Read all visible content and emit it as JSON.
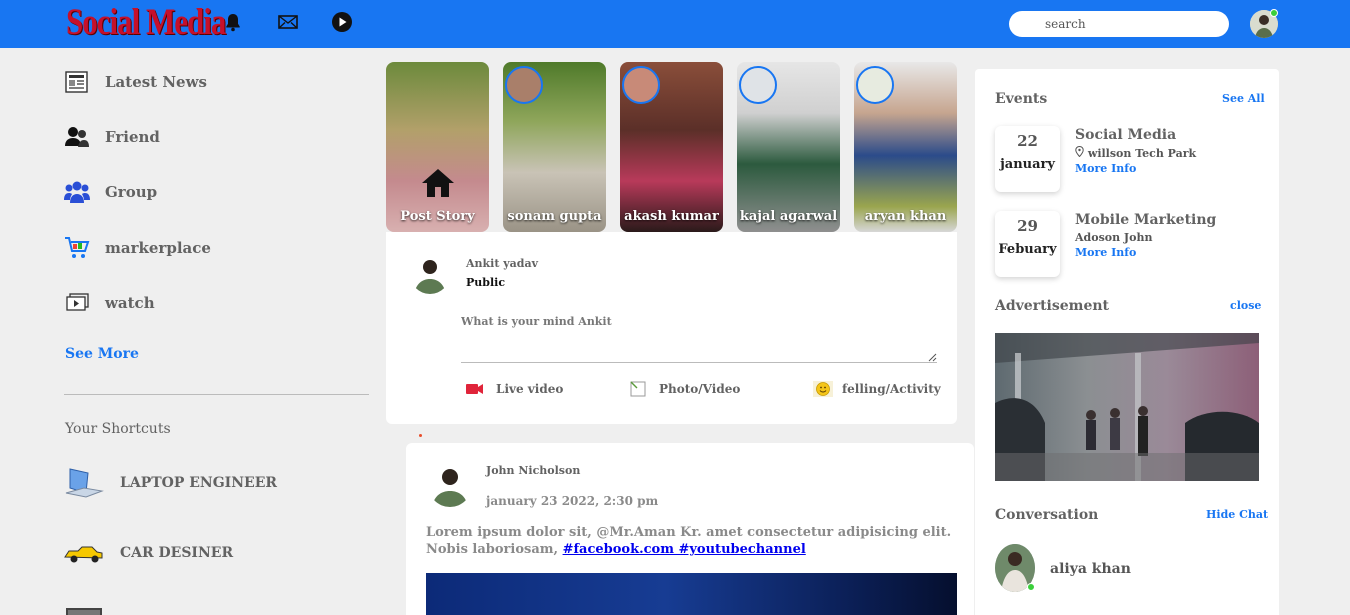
{
  "topbar": {
    "logo": "Social Media",
    "icons": [
      "bell-icon",
      "mail-icon",
      "play-icon"
    ],
    "search_placeholder": "search",
    "brand_color": "#1876f2"
  },
  "left_nav": {
    "items": [
      {
        "label": "Latest News",
        "icon": "newspaper-icon"
      },
      {
        "label": "Friend",
        "icon": "friends-icon"
      },
      {
        "label": "Group",
        "icon": "group-icon"
      },
      {
        "label": "markerplace",
        "icon": "cart-icon"
      },
      {
        "label": "watch",
        "icon": "video-icon"
      }
    ],
    "see_more": "See More",
    "shortcuts_title": "Your Shortcuts",
    "shortcuts": [
      {
        "label": "LAPTOP ENGINEER",
        "icon": "laptop-icon"
      },
      {
        "label": "CAR DESINER",
        "icon": "car-icon"
      }
    ]
  },
  "stories": [
    {
      "name": "Post Story",
      "type": "post"
    },
    {
      "name": "sonam gupta"
    },
    {
      "name": "akash kumar"
    },
    {
      "name": "kajal agarwal"
    },
    {
      "name": "aryan khan"
    }
  ],
  "composer": {
    "user_name": "Ankit yadav",
    "privacy": "Public",
    "placeholder": "What is your mind Ankit",
    "actions": [
      {
        "label": "Live video",
        "icon": "live-icon"
      },
      {
        "label": "Photo/Video",
        "icon": "photo-icon"
      },
      {
        "label": "felling/Activity",
        "icon": "smile-icon"
      }
    ]
  },
  "post": {
    "author": "John Nicholson",
    "date": "january 23 2022, 2:30 pm",
    "text": "Lorem ipsum dolor sit, @Mr.Aman Kr. amet consectetur adipisicing elit. Nobis laboriosam,",
    "links": "#facebook.com #youtubechannel"
  },
  "right": {
    "events_title": "Events",
    "see_all": "See All",
    "events": [
      {
        "day": "22",
        "month": "january",
        "title": "Social Media",
        "subtitle": "willson Tech Park",
        "more": "More Info"
      },
      {
        "day": "29",
        "month": "Febuary",
        "title": "Mobile Marketing",
        "subtitle": "Adoson John",
        "more": "More Info"
      }
    ],
    "ad_title": "Advertisement",
    "ad_close": "close",
    "conversation_title": "Conversation",
    "hide_chat": "Hide Chat",
    "chat_user": "aliya khan"
  }
}
